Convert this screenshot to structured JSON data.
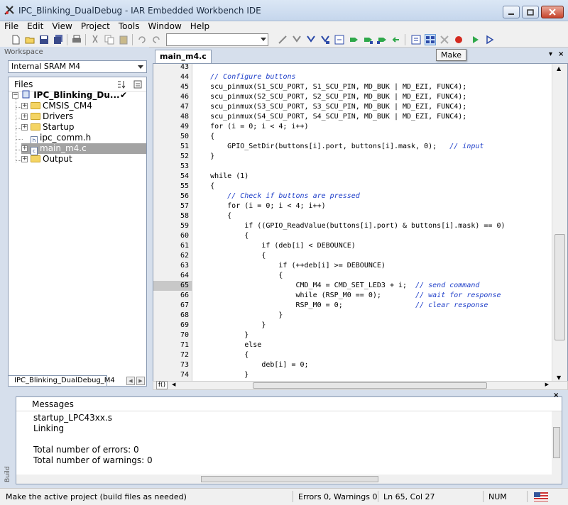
{
  "window": {
    "title": "IPC_Blinking_DualDebug - IAR Embedded Workbench IDE"
  },
  "menu": [
    "File",
    "Edit",
    "View",
    "Project",
    "Tools",
    "Window",
    "Help"
  ],
  "toolbar": {
    "tooltip": "Make",
    "find_combo_value": ""
  },
  "workspace": {
    "header": "Workspace",
    "config": "Internal SRAM M4",
    "files_label": "Files",
    "tree": [
      {
        "label": "IPC_Blinking_Du...",
        "kind": "project"
      },
      {
        "label": "CMSIS_CM4",
        "kind": "folder"
      },
      {
        "label": "Drivers",
        "kind": "folder"
      },
      {
        "label": "Startup",
        "kind": "folder"
      },
      {
        "label": "ipc_comm.h",
        "kind": "header"
      },
      {
        "label": "main_m4.c",
        "kind": "source"
      },
      {
        "label": "Output",
        "kind": "folder"
      }
    ],
    "tab": "IPC_Blinking_DualDebug_M4"
  },
  "editor": {
    "tab": "main_m4.c",
    "current_line": 65,
    "lines": [
      {
        "n": "43",
        "code": "",
        "cm": ""
      },
      {
        "n": "44",
        "code": "    ",
        "cm": "// Configure buttons"
      },
      {
        "n": "45",
        "code": "    scu_pinmux(S1_SCU_PORT, S1_SCU_PIN, MD_BUK | MD_EZI, FUNC4);",
        "cm": ""
      },
      {
        "n": "46",
        "code": "    scu_pinmux(S2_SCU_PORT, S2_SCU_PIN, MD_BUK | MD_EZI, FUNC4);",
        "cm": ""
      },
      {
        "n": "47",
        "code": "    scu_pinmux(S3_SCU_PORT, S3_SCU_PIN, MD_BUK | MD_EZI, FUNC4);",
        "cm": ""
      },
      {
        "n": "48",
        "code": "    scu_pinmux(S4_SCU_PORT, S4_SCU_PIN, MD_BUK | MD_EZI, FUNC4);",
        "cm": ""
      },
      {
        "n": "49",
        "code": "    for (i = 0; i < 4; i++)",
        "cm": ""
      },
      {
        "n": "50",
        "code": "    {",
        "cm": ""
      },
      {
        "n": "51",
        "code": "        GPIO_SetDir(buttons[i].port, buttons[i].mask, 0);   ",
        "cm": "// input"
      },
      {
        "n": "52",
        "code": "    }",
        "cm": ""
      },
      {
        "n": "53",
        "code": "",
        "cm": ""
      },
      {
        "n": "54",
        "code": "    while (1)",
        "cm": ""
      },
      {
        "n": "55",
        "code": "    {",
        "cm": ""
      },
      {
        "n": "56",
        "code": "        ",
        "cm": "// Check if buttons are pressed"
      },
      {
        "n": "57",
        "code": "        for (i = 0; i < 4; i++)",
        "cm": ""
      },
      {
        "n": "58",
        "code": "        {",
        "cm": ""
      },
      {
        "n": "59",
        "code": "            if ((GPIO_ReadValue(buttons[i].port) & buttons[i].mask) == 0)",
        "cm": ""
      },
      {
        "n": "60",
        "code": "            {",
        "cm": ""
      },
      {
        "n": "61",
        "code": "                if (deb[i] < DEBOUNCE)",
        "cm": ""
      },
      {
        "n": "62",
        "code": "                {",
        "cm": ""
      },
      {
        "n": "63",
        "code": "                    if (++deb[i] >= DEBOUNCE)",
        "cm": ""
      },
      {
        "n": "64",
        "code": "                    {",
        "cm": ""
      },
      {
        "n": "65",
        "code": "                        CMD_M4 = CMD_SET_LED3 + i;  ",
        "cm": "// send command"
      },
      {
        "n": "66",
        "code": "                        while (RSP_M0 == 0);        ",
        "cm": "// wait for response"
      },
      {
        "n": "67",
        "code": "                        RSP_M0 = 0;                 ",
        "cm": "// clear response"
      },
      {
        "n": "68",
        "code": "                    }",
        "cm": ""
      },
      {
        "n": "69",
        "code": "                }",
        "cm": ""
      },
      {
        "n": "70",
        "code": "            }",
        "cm": ""
      },
      {
        "n": "71",
        "code": "            else",
        "cm": ""
      },
      {
        "n": "72",
        "code": "            {",
        "cm": ""
      },
      {
        "n": "73",
        "code": "                deb[i] = 0;",
        "cm": ""
      },
      {
        "n": "74",
        "code": "            }",
        "cm": ""
      }
    ],
    "fn_button": "f()"
  },
  "messages": {
    "header": "Messages",
    "side_tab": "Build",
    "lines": [
      "startup_LPC43xx.s",
      "Linking",
      "",
      "Total number of errors: 0",
      "Total number of warnings: 0"
    ]
  },
  "status": {
    "hint": "Make the active project (build files as needed)",
    "errors": "Errors 0, Warnings 0",
    "position": "Ln 65, Col 27",
    "num": "NUM"
  }
}
